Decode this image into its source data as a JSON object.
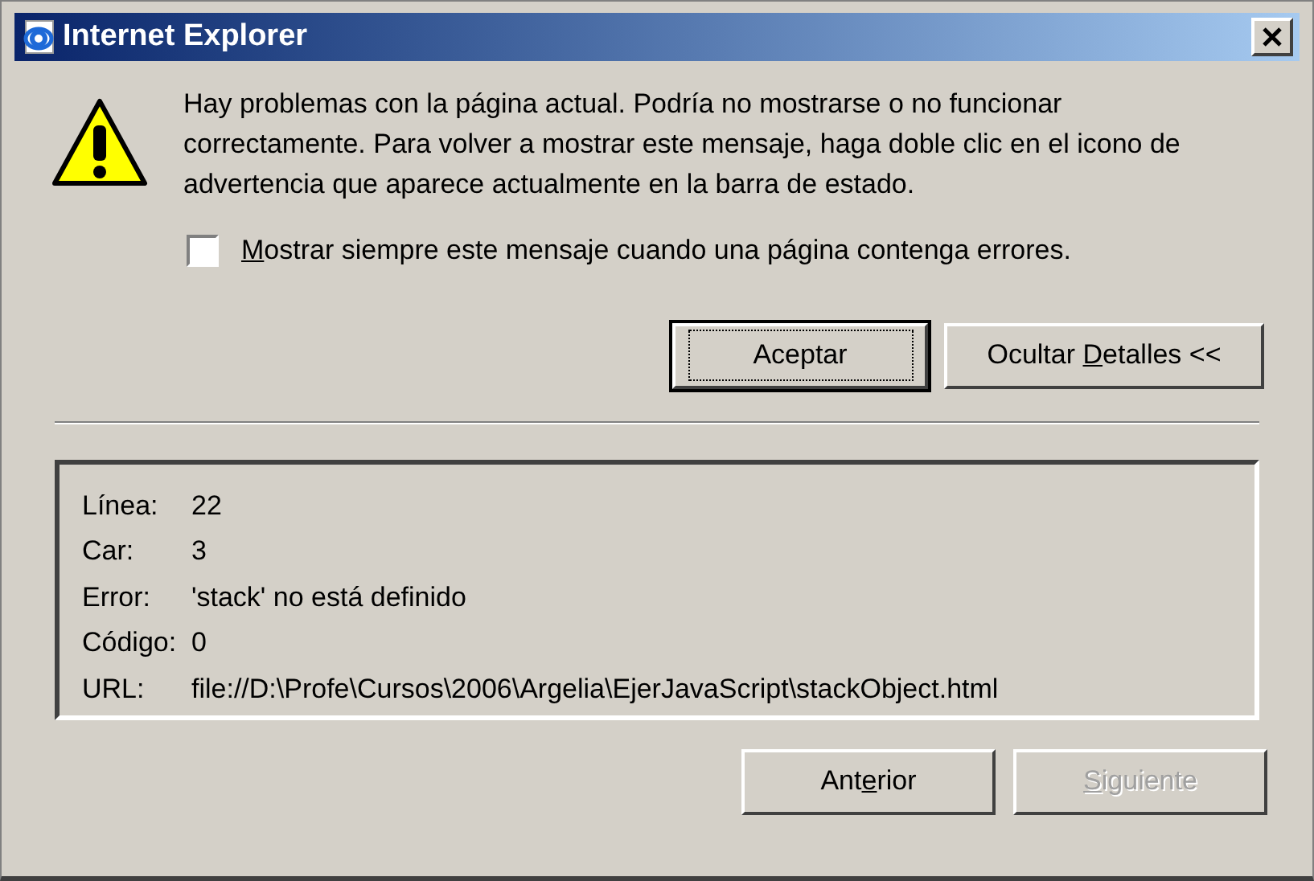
{
  "window": {
    "title": "Internet Explorer"
  },
  "message": "Hay problemas con la página actual. Podría no mostrarse o no funcionar correctamente. Para volver a mostrar este mensaje, haga doble clic en el icono de advertencia que aparece actualmente en la barra de estado.",
  "always_show": {
    "label_parts": [
      {
        "text": "M",
        "underlined": true
      },
      {
        "text": "ostrar siempre este mensaje cuando una página contenga errores.",
        "underlined": false
      }
    ],
    "checked": false
  },
  "buttons": [
    {
      "label_parts": [
        {
          "text": "Aceptar",
          "underlined": false
        }
      ],
      "default": true,
      "disabled": false
    },
    {
      "label_parts": [
        {
          "text": "Ocultar ",
          "underlined": false
        },
        {
          "text": "D",
          "underlined": true
        },
        {
          "text": "etalles <<",
          "underlined": false
        }
      ],
      "default": false,
      "disabled": false
    }
  ],
  "details": [
    {
      "label": "Línea:",
      "value": "22"
    },
    {
      "label": "Car:",
      "value": "3"
    },
    {
      "label": "Error:",
      "value": "'stack' no está definido"
    },
    {
      "label": "Código:",
      "value": "0"
    },
    {
      "label": "URL:",
      "value": "file://D:\\Profe\\Cursos\\2006\\Argelia\\EjerJavaScript\\stackObject.html"
    }
  ],
  "nav_buttons": [
    {
      "label_parts": [
        {
          "text": "Ant",
          "underlined": false
        },
        {
          "text": "e",
          "underlined": true
        },
        {
          "text": "rior",
          "underlined": false
        }
      ],
      "default": false,
      "disabled": false
    },
    {
      "label_parts": [
        {
          "text": "S",
          "underlined": true
        },
        {
          "text": "iguiente",
          "underlined": false
        }
      ],
      "default": false,
      "disabled": true
    }
  ]
}
